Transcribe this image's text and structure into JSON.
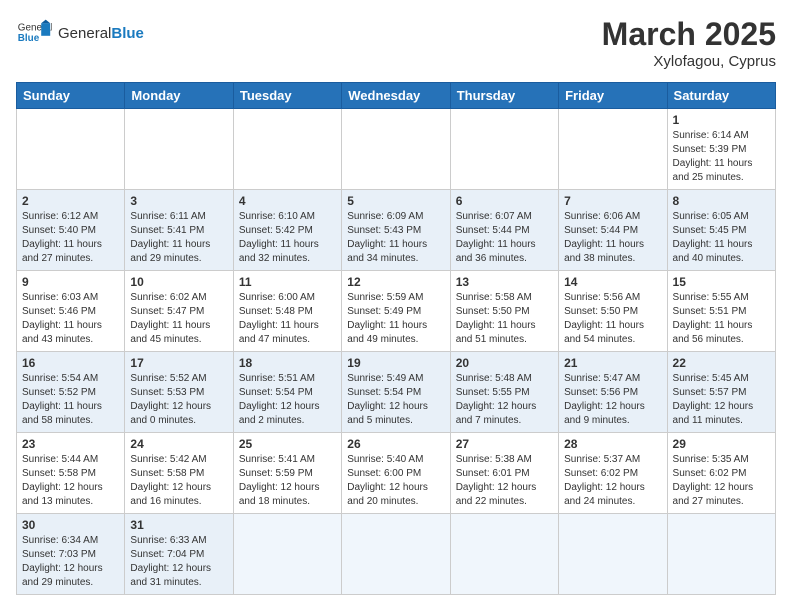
{
  "header": {
    "logo_general": "General",
    "logo_blue": "Blue",
    "month_year": "March 2025",
    "location": "Xylofagou, Cyprus"
  },
  "weekdays": [
    "Sunday",
    "Monday",
    "Tuesday",
    "Wednesday",
    "Thursday",
    "Friday",
    "Saturday"
  ],
  "weeks": [
    [
      {
        "day": "",
        "info": ""
      },
      {
        "day": "",
        "info": ""
      },
      {
        "day": "",
        "info": ""
      },
      {
        "day": "",
        "info": ""
      },
      {
        "day": "",
        "info": ""
      },
      {
        "day": "",
        "info": ""
      },
      {
        "day": "1",
        "info": "Sunrise: 6:14 AM\nSunset: 5:39 PM\nDaylight: 11 hours and 25 minutes."
      }
    ],
    [
      {
        "day": "2",
        "info": "Sunrise: 6:12 AM\nSunset: 5:40 PM\nDaylight: 11 hours and 27 minutes."
      },
      {
        "day": "3",
        "info": "Sunrise: 6:11 AM\nSunset: 5:41 PM\nDaylight: 11 hours and 29 minutes."
      },
      {
        "day": "4",
        "info": "Sunrise: 6:10 AM\nSunset: 5:42 PM\nDaylight: 11 hours and 32 minutes."
      },
      {
        "day": "5",
        "info": "Sunrise: 6:09 AM\nSunset: 5:43 PM\nDaylight: 11 hours and 34 minutes."
      },
      {
        "day": "6",
        "info": "Sunrise: 6:07 AM\nSunset: 5:44 PM\nDaylight: 11 hours and 36 minutes."
      },
      {
        "day": "7",
        "info": "Sunrise: 6:06 AM\nSunset: 5:44 PM\nDaylight: 11 hours and 38 minutes."
      },
      {
        "day": "8",
        "info": "Sunrise: 6:05 AM\nSunset: 5:45 PM\nDaylight: 11 hours and 40 minutes."
      }
    ],
    [
      {
        "day": "9",
        "info": "Sunrise: 6:03 AM\nSunset: 5:46 PM\nDaylight: 11 hours and 43 minutes."
      },
      {
        "day": "10",
        "info": "Sunrise: 6:02 AM\nSunset: 5:47 PM\nDaylight: 11 hours and 45 minutes."
      },
      {
        "day": "11",
        "info": "Sunrise: 6:00 AM\nSunset: 5:48 PM\nDaylight: 11 hours and 47 minutes."
      },
      {
        "day": "12",
        "info": "Sunrise: 5:59 AM\nSunset: 5:49 PM\nDaylight: 11 hours and 49 minutes."
      },
      {
        "day": "13",
        "info": "Sunrise: 5:58 AM\nSunset: 5:50 PM\nDaylight: 11 hours and 51 minutes."
      },
      {
        "day": "14",
        "info": "Sunrise: 5:56 AM\nSunset: 5:50 PM\nDaylight: 11 hours and 54 minutes."
      },
      {
        "day": "15",
        "info": "Sunrise: 5:55 AM\nSunset: 5:51 PM\nDaylight: 11 hours and 56 minutes."
      }
    ],
    [
      {
        "day": "16",
        "info": "Sunrise: 5:54 AM\nSunset: 5:52 PM\nDaylight: 11 hours and 58 minutes."
      },
      {
        "day": "17",
        "info": "Sunrise: 5:52 AM\nSunset: 5:53 PM\nDaylight: 12 hours and 0 minutes."
      },
      {
        "day": "18",
        "info": "Sunrise: 5:51 AM\nSunset: 5:54 PM\nDaylight: 12 hours and 2 minutes."
      },
      {
        "day": "19",
        "info": "Sunrise: 5:49 AM\nSunset: 5:54 PM\nDaylight: 12 hours and 5 minutes."
      },
      {
        "day": "20",
        "info": "Sunrise: 5:48 AM\nSunset: 5:55 PM\nDaylight: 12 hours and 7 minutes."
      },
      {
        "day": "21",
        "info": "Sunrise: 5:47 AM\nSunset: 5:56 PM\nDaylight: 12 hours and 9 minutes."
      },
      {
        "day": "22",
        "info": "Sunrise: 5:45 AM\nSunset: 5:57 PM\nDaylight: 12 hours and 11 minutes."
      }
    ],
    [
      {
        "day": "23",
        "info": "Sunrise: 5:44 AM\nSunset: 5:58 PM\nDaylight: 12 hours and 13 minutes."
      },
      {
        "day": "24",
        "info": "Sunrise: 5:42 AM\nSunset: 5:58 PM\nDaylight: 12 hours and 16 minutes."
      },
      {
        "day": "25",
        "info": "Sunrise: 5:41 AM\nSunset: 5:59 PM\nDaylight: 12 hours and 18 minutes."
      },
      {
        "day": "26",
        "info": "Sunrise: 5:40 AM\nSunset: 6:00 PM\nDaylight: 12 hours and 20 minutes."
      },
      {
        "day": "27",
        "info": "Sunrise: 5:38 AM\nSunset: 6:01 PM\nDaylight: 12 hours and 22 minutes."
      },
      {
        "day": "28",
        "info": "Sunrise: 5:37 AM\nSunset: 6:02 PM\nDaylight: 12 hours and 24 minutes."
      },
      {
        "day": "29",
        "info": "Sunrise: 5:35 AM\nSunset: 6:02 PM\nDaylight: 12 hours and 27 minutes."
      }
    ],
    [
      {
        "day": "30",
        "info": "Sunrise: 6:34 AM\nSunset: 7:03 PM\nDaylight: 12 hours and 29 minutes."
      },
      {
        "day": "31",
        "info": "Sunrise: 6:33 AM\nSunset: 7:04 PM\nDaylight: 12 hours and 31 minutes."
      },
      {
        "day": "",
        "info": ""
      },
      {
        "day": "",
        "info": ""
      },
      {
        "day": "",
        "info": ""
      },
      {
        "day": "",
        "info": ""
      },
      {
        "day": "",
        "info": ""
      }
    ]
  ]
}
